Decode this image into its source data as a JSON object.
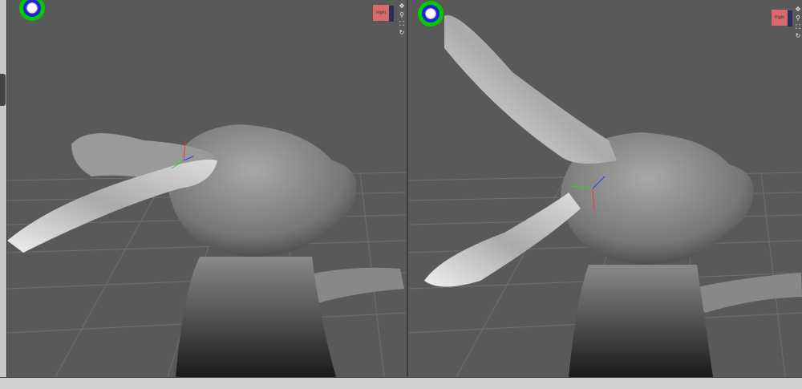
{
  "viewports": [
    {
      "name": "left",
      "view_cube_label": "Right",
      "nav_icons": [
        "move-icon",
        "zoom-icon",
        "frame-icon",
        "orbit-icon"
      ]
    },
    {
      "name": "right",
      "view_cube_label": "Right",
      "nav_icons": [
        "move-icon",
        "zoom-icon",
        "frame-icon",
        "orbit-icon"
      ]
    }
  ],
  "colors": {
    "background": "#595959",
    "grid": "#6c6c6c",
    "orb_red": "#e00000",
    "orb_green": "#00c000",
    "orb_blue": "#2020dd"
  }
}
